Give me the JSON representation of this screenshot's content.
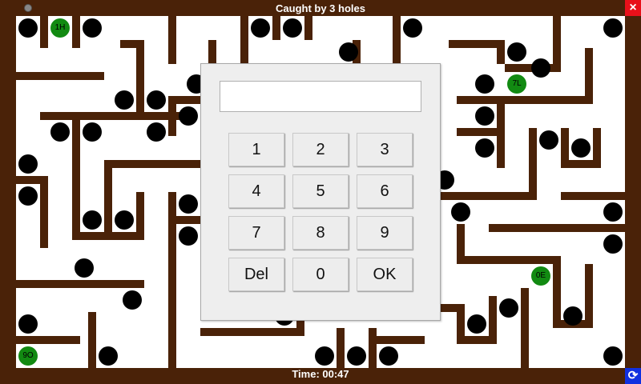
{
  "header": {
    "title": "Caught by 3 holes"
  },
  "footer": {
    "timer": "Time: 00:47"
  },
  "controls": {
    "close_icon": "×",
    "restart_icon": "⟳"
  },
  "colors": {
    "wall": "#4a2208",
    "hole": "#000000",
    "target": "#128a12",
    "close": "#e8101a",
    "restart": "#1030e0"
  },
  "targets": [
    "1H",
    "7L",
    "0E",
    "9O"
  ],
  "keypad": {
    "display_value": "",
    "keys": [
      "1",
      "2",
      "3",
      "4",
      "5",
      "6",
      "7",
      "8",
      "9",
      "Del",
      "0",
      "OK"
    ]
  }
}
